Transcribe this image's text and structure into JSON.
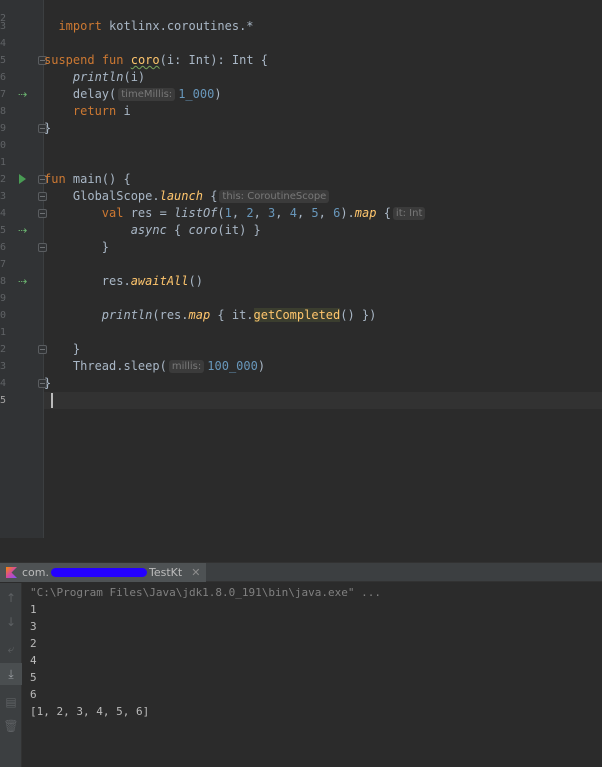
{
  "editor": {
    "line_numbers": [
      "2",
      "3",
      "4",
      "5",
      "6",
      "7",
      "8",
      "9",
      "0",
      "1",
      "2",
      "3",
      "4",
      "5",
      "6",
      "7",
      "8",
      "9",
      "0",
      "1",
      "2",
      "3",
      "4",
      "5"
    ],
    "code": {
      "import_kw": "import",
      "import_path": " kotlinx.coroutines.*",
      "suspend_kw": "suspend",
      "fun_kw": "fun",
      "coro_name": "coro",
      "coro_sig": "(i: Int): Int {",
      "println_fn": "println",
      "println_arg": "(i)",
      "delay_fn": "delay(",
      "delay_hint": "timeMillis:",
      "delay_value": "1_000",
      "close_paren": ")",
      "return_kw": "return",
      "return_val": " i",
      "close_brace": "}",
      "main_sig": " main() {",
      "globalscope": "GlobalScope.",
      "launch_fn": "launch",
      "launch_open": " {",
      "launch_hint": "this: CoroutineScope",
      "val_kw": "val",
      "res_assign": " res = ",
      "listof_fn": "listOf",
      "listof_open": "(",
      "n1": "1",
      "n2": "2",
      "n3": "3",
      "n4": "4",
      "n5": "5",
      "n6": "6",
      "comma": ", ",
      "map_dot": ").",
      "map_fn": "map",
      "map_open": " {",
      "map_hint": "it: Int",
      "async_fn": "async",
      "async_body_open": " { ",
      "coro_call": "coro",
      "coro_call_arg": "(it) }",
      "res_dot": "res.",
      "await_fn": "awaitAll",
      "await_args": "()",
      "println2_fn": "println",
      "println2_open": "(res.",
      "map2_fn": "map",
      "map2_body": " { it.",
      "getcompleted_fn": "getCompleted",
      "map2_close": "() })",
      "thread_sleep": "Thread.sleep(",
      "sleep_hint": "millis:",
      "sleep_value": "100_000"
    }
  },
  "run_window": {
    "tab_prefix": "com.",
    "tab_suffix": "TestKt",
    "tab_close": "✕",
    "console_lines": [
      "\"C:\\Program Files\\Java\\jdk1.8.0_191\\bin\\java.exe\" ...",
      "1",
      "3",
      "2",
      "4",
      "5",
      "6",
      "[1, 2, 3, 4, 5, 6]"
    ],
    "toolbar_glyphs": {
      "rerun": "↑",
      "scroll": "↓",
      "wrap": "⤶",
      "down": "⤓",
      "print": "▤",
      "trash": "🗑"
    }
  },
  "colors": {
    "editor_bg": "#2b2b2b",
    "keyword": "#cc7832",
    "function": "#ffc66d",
    "number": "#6897bb",
    "text": "#a9b7c6",
    "redaction": "#2400ff"
  }
}
